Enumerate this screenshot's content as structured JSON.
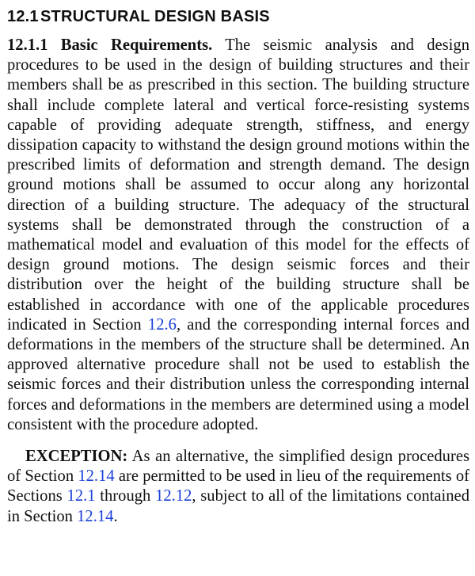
{
  "heading": {
    "number": "12.1",
    "title": "STRUCTURAL DESIGN BASIS"
  },
  "requirements": {
    "subhead": "12.1.1 Basic Requirements.",
    "text_before_ref": " The seismic analysis and design procedures to be used in the design of building structures and their members shall be as prescribed in this section. The building structure shall include complete lateral and vertical force-­resisting systems capable of providing adequate strength, stiffness, and energy dissipation capacity to withstand the design ground motions within the prescribed limits of deformation and strength demand. The design ground motions shall be assumed to occur along any horizontal direction of a building structure. The adequacy of the structural systems shall be demonstrated through the construction of a mathematical model and evaluation of this model for the effects of design ground motions. The design seismic forces and their distribution over the height of the building structure shall be established in accordance with one of the applicable procedures indicated in Section ",
    "ref": "12.6",
    "text_after_ref": ", and the corresponding internal forces and deformations in the members of the structure shall be determined. An approved alternative procedure shall not be used to establish the seismic forces and their distribution unless the corresponding internal forces and deformations in the members are determined using a model consistent with the procedure adopted."
  },
  "exception": {
    "label": "EXCEPTION:",
    "text_1": " As an alternative, the simplified design pro­cedures of Section ",
    "ref_1": "12.14",
    "text_2": " are permitted to be used in lieu of the requirements of Sections ",
    "ref_2": "12.1",
    "text_3": " through ",
    "ref_3": "12.12",
    "text_4": ", subject to all of the limitations contained in Section ",
    "ref_4": "12.14",
    "text_5": "."
  },
  "colors": {
    "text": "#111111",
    "link": "#1a3ed9",
    "background": "#ffffff"
  }
}
